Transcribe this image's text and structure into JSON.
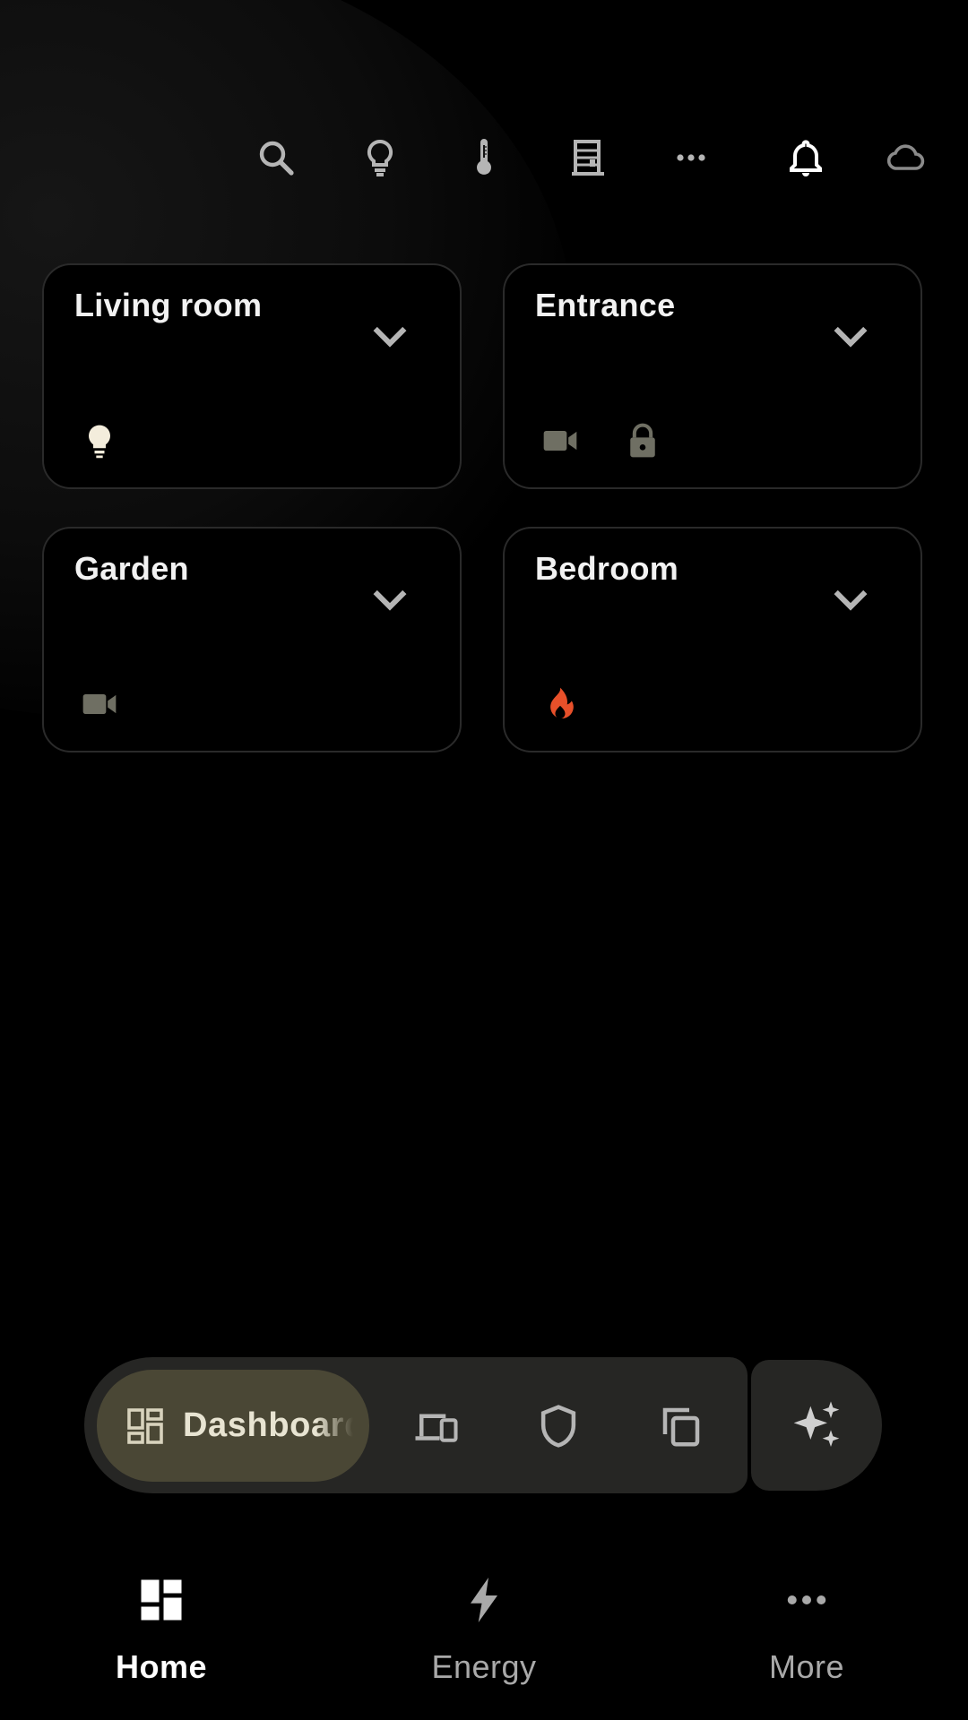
{
  "toolbar": {
    "icons": [
      "search-icon",
      "lightbulb-icon",
      "thermometer-icon",
      "building-icon",
      "more-horiz-icon",
      "bell-icon",
      "cloud-icon"
    ]
  },
  "rooms": [
    {
      "name": "Living room",
      "icons": [
        "lightbulb-on-icon"
      ]
    },
    {
      "name": "Entrance",
      "icons": [
        "video-camera-icon",
        "lock-icon"
      ]
    },
    {
      "name": "Garden",
      "icons": [
        "video-camera-icon"
      ]
    },
    {
      "name": "Bedroom",
      "icons": [
        "flame-icon"
      ]
    }
  ],
  "pill": {
    "active_label": "Dashboard",
    "buttons": [
      "devices-icon",
      "shield-icon",
      "copy-icon"
    ],
    "assist": "sparkles-icon"
  },
  "nav": {
    "items": [
      {
        "label": "Home",
        "icon": "dashboard-grid-icon",
        "active": true
      },
      {
        "label": "Energy",
        "icon": "lightning-bolt-icon",
        "active": false
      },
      {
        "label": "More",
        "icon": "more-horiz-icon",
        "active": false
      }
    ]
  },
  "colors": {
    "background": "#000000",
    "card_border": "#2a2a2a",
    "icon_muted": "#b5b5b5",
    "icon_inactive": "#6f6f63",
    "flame": "#e8502a",
    "pill_bg": "#262624",
    "pill_active": "#4a4735",
    "nav_active": "#ffffff",
    "nav_inactive": "#a9a9a9"
  }
}
